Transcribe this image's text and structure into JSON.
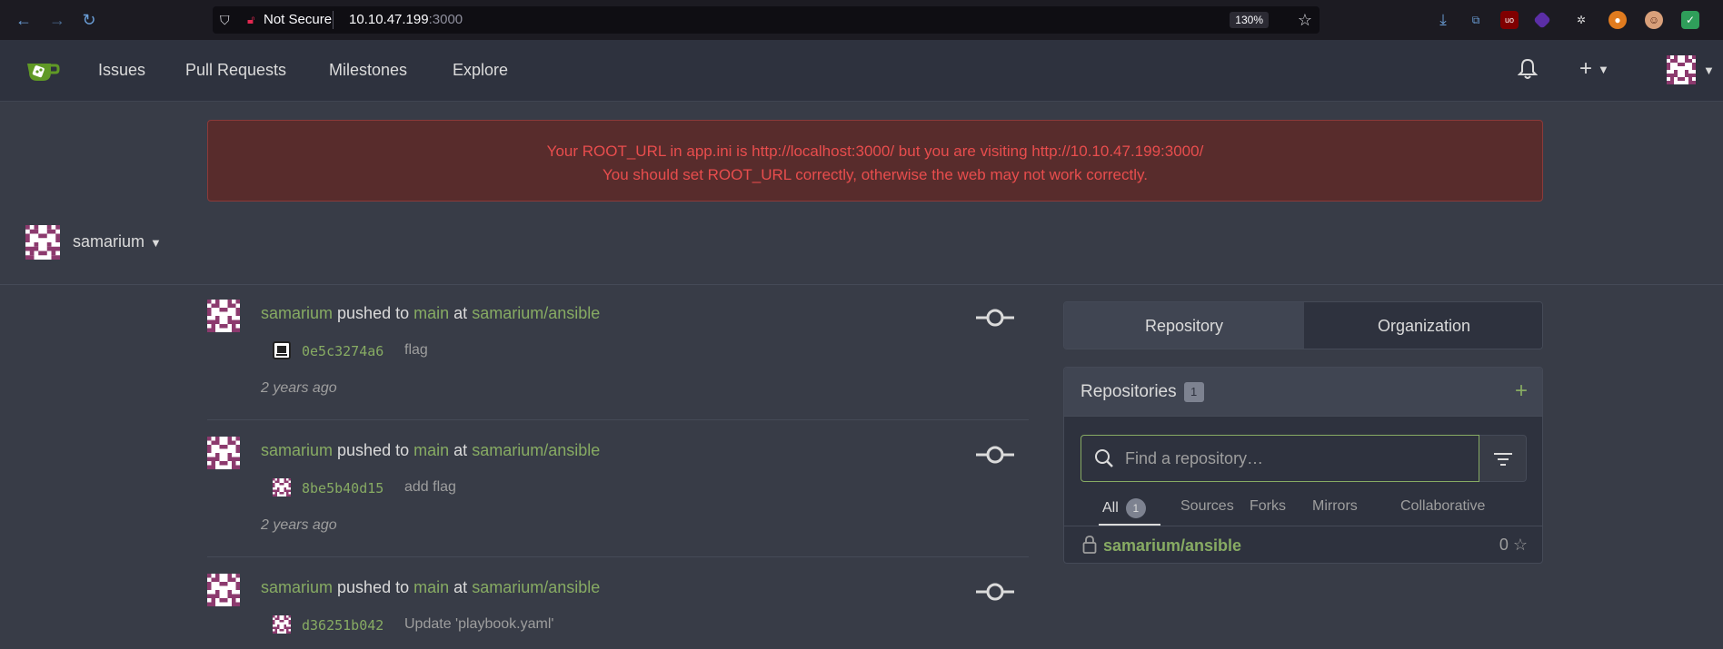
{
  "browser": {
    "security_label": "Not Secure",
    "url_host": "10.10.47.199",
    "url_port": ":3000",
    "zoom": "130%"
  },
  "header": {
    "nav": [
      "Issues",
      "Pull Requests",
      "Milestones",
      "Explore"
    ]
  },
  "error": {
    "line1": "Your ROOT_URL in app.ini is http://localhost:3000/ but you are visiting http://10.10.47.199:3000/",
    "line2": "You should set ROOT_URL correctly, otherwise the web may not work correctly."
  },
  "dashboard": {
    "user": "samarium"
  },
  "feed": [
    {
      "user": "samarium",
      "action": "pushed to",
      "branch": "main",
      "at": "at",
      "repo": "samarium/ansible",
      "sha": "0e5c3274a6",
      "message": "flag",
      "time": "2 years ago"
    },
    {
      "user": "samarium",
      "action": "pushed to",
      "branch": "main",
      "at": "at",
      "repo": "samarium/ansible",
      "sha": "8be5b40d15",
      "message": "add flag",
      "time": "2 years ago"
    },
    {
      "user": "samarium",
      "action": "pushed to",
      "branch": "main",
      "at": "at",
      "repo": "samarium/ansible",
      "sha": "d36251b042",
      "message": "Update 'playbook.yaml'",
      "time": ""
    }
  ],
  "panel": {
    "tab_repository": "Repository",
    "tab_organization": "Organization",
    "repos_title": "Repositories",
    "repos_count": "1",
    "search_placeholder": "Find a repository…",
    "filters": {
      "all": "All",
      "all_count": "1",
      "sources": "Sources",
      "forks": "Forks",
      "mirrors": "Mirrors",
      "collaborative": "Collaborative"
    },
    "repo_name": "samarium/ansible",
    "repo_stars": "0"
  },
  "colors": {
    "accent_green": "#87ab63",
    "error_text": "#e84d4d",
    "error_bg": "#582c2c"
  }
}
